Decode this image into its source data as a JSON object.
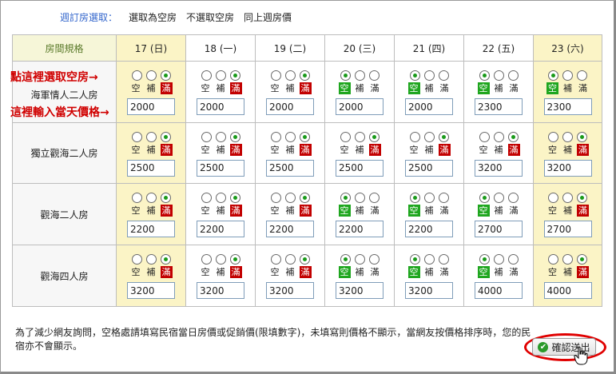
{
  "quick_select": {
    "label": "週訂房選取：",
    "actions": [
      "選取為空房",
      "不選取空房",
      "同上週房價"
    ]
  },
  "table": {
    "room_header": "房間規格",
    "dates": [
      "17 (日)",
      "18 (一)",
      "19 (二)",
      "20 (三)",
      "21 (四)",
      "22 (五)",
      "23 (六)"
    ],
    "weekend_columns": [
      0,
      6
    ],
    "status_labels": [
      "空",
      "補",
      "滿"
    ],
    "rows": [
      {
        "name": "海軍情人二人房",
        "status": [
          "full",
          "full",
          "full",
          "vacant",
          "vacant",
          "vacant",
          "vacant"
        ],
        "prices": [
          "2000",
          "2000",
          "2000",
          "2000",
          "2000",
          "2300",
          "2300"
        ]
      },
      {
        "name": "獨立觀海二人房",
        "status": [
          "full",
          "full",
          "full",
          "full",
          "full",
          "full",
          "full"
        ],
        "prices": [
          "2500",
          "2500",
          "2500",
          "2500",
          "2500",
          "3200",
          "3200"
        ]
      },
      {
        "name": "觀海二人房",
        "status": [
          "full",
          "full",
          "full",
          "vacant",
          "vacant",
          "vacant",
          "full"
        ],
        "prices": [
          "2200",
          "2200",
          "2200",
          "2200",
          "2200",
          "2700",
          "2700"
        ]
      },
      {
        "name": "觀海四人房",
        "status": [
          "full",
          "full",
          "full",
          "vacant",
          "vacant",
          "vacant",
          "full"
        ],
        "prices": [
          "3200",
          "3200",
          "3200",
          "3200",
          "3200",
          "4000",
          "4000"
        ]
      }
    ]
  },
  "annotations": {
    "select_vacancy": "點這裡選取空房→",
    "enter_price": "這裡輸入當天價格→"
  },
  "notice": "為了減少網友詢問，空格處請填寫民宿當日房價或促銷價(限填數字)，未填寫則價格不顯示，當網友按價格排序時，您的民宿亦不會顯示。",
  "submit": {
    "label": "確認送出",
    "icon": "check-icon"
  },
  "colors": {
    "vacant_badge": "#1fa61f",
    "full_badge": "#c20000",
    "weekend_bg": "#fbf4c6",
    "annotation": "#d00000",
    "highlight_ring": "#e00000"
  }
}
